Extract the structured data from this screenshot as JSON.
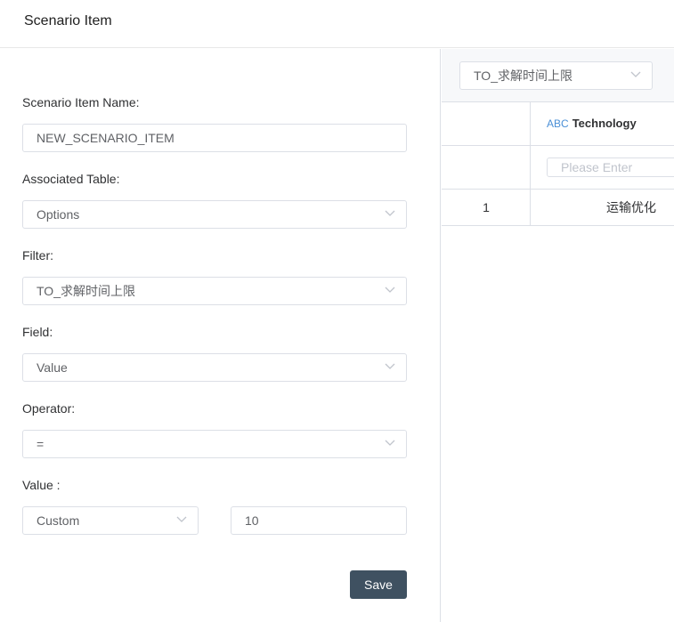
{
  "header": {
    "title": "Scenario Item"
  },
  "form": {
    "name_label": "Scenario Item Name:",
    "name_value": "NEW_SCENARIO_ITEM",
    "table_label": "Associated Table:",
    "table_value": "Options",
    "filter_label": "Filter:",
    "filter_value": "TO_求解时间上限",
    "field_label": "Field:",
    "field_value": "Value",
    "operator_label": "Operator:",
    "operator_value": "=",
    "value_label": "Value :",
    "value_mode": "Custom",
    "value_input": "10",
    "save_label": "Save"
  },
  "preview": {
    "filter_select": "TO_求解时间上限",
    "column_type": "ABC",
    "column_name": "Technology",
    "filter_placeholder": "Please Enter",
    "rows": [
      {
        "index": "1",
        "technology": "运输优化"
      }
    ]
  },
  "icons": {
    "select_caret": "chevron-down-icon"
  },
  "colors": {
    "save_button_bg": "#3f5161",
    "type_tag": "#4a8fd6",
    "border": "#dcdfe6"
  }
}
